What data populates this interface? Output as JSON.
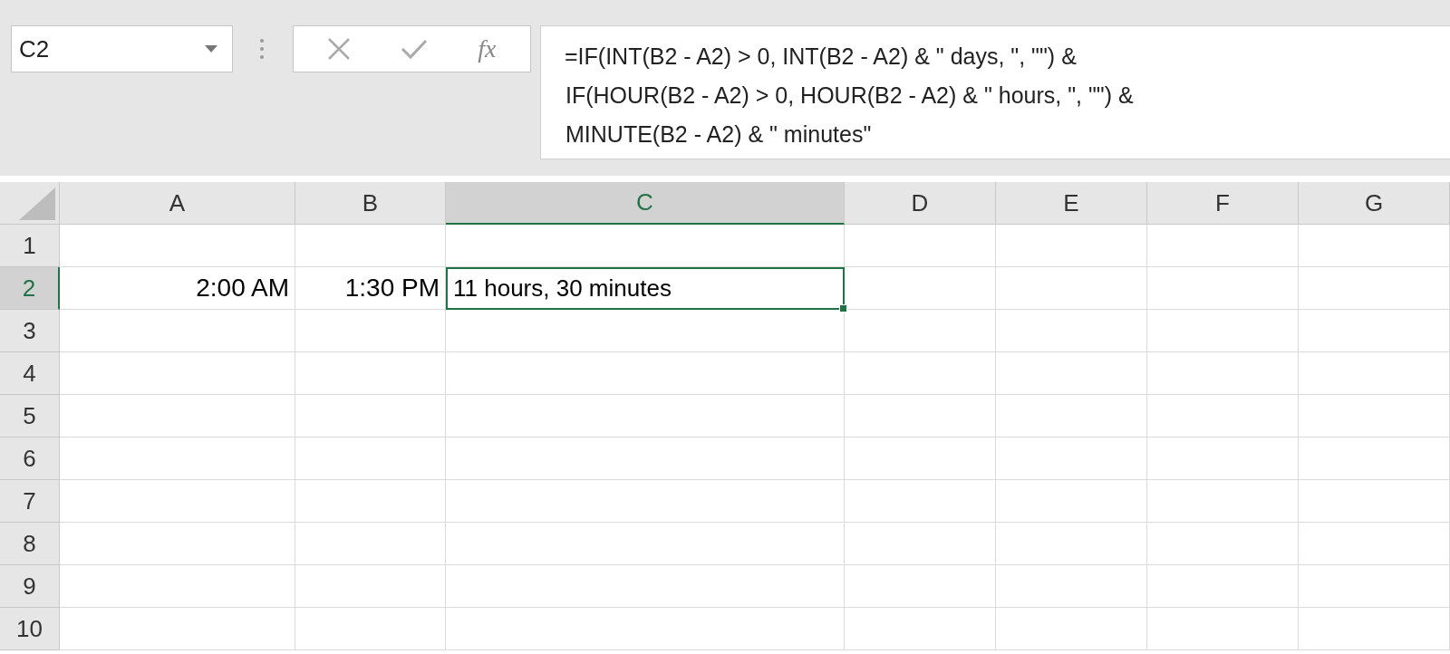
{
  "name_box": {
    "value": "C2"
  },
  "formula_bar": {
    "function_label": "fx",
    "lines": [
      "=IF(INT(B2 - A2) > 0, INT(B2 - A2) & \" days, \", \"\") &",
      "IF(HOUR(B2 - A2) > 0, HOUR(B2 - A2) & \" hours, \", \"\") &",
      "MINUTE(B2 - A2) & \" minutes\""
    ]
  },
  "columns": [
    {
      "label": "A",
      "selected": false
    },
    {
      "label": "B",
      "selected": false
    },
    {
      "label": "C",
      "selected": true
    },
    {
      "label": "D",
      "selected": false
    },
    {
      "label": "E",
      "selected": false
    },
    {
      "label": "F",
      "selected": false
    },
    {
      "label": "G",
      "selected": false
    }
  ],
  "rows": [
    {
      "label": "1",
      "selected": false,
      "cells": [
        "",
        "",
        "",
        "",
        "",
        "",
        ""
      ]
    },
    {
      "label": "2",
      "selected": true,
      "cells": [
        "2:00 AM",
        "1:30 PM",
        "11 hours, 30 minutes",
        "",
        "",
        "",
        ""
      ]
    },
    {
      "label": "3",
      "selected": false,
      "cells": [
        "",
        "",
        "",
        "",
        "",
        "",
        ""
      ]
    },
    {
      "label": "4",
      "selected": false,
      "cells": [
        "",
        "",
        "",
        "",
        "",
        "",
        ""
      ]
    },
    {
      "label": "5",
      "selected": false,
      "cells": [
        "",
        "",
        "",
        "",
        "",
        "",
        ""
      ]
    },
    {
      "label": "6",
      "selected": false,
      "cells": [
        "",
        "",
        "",
        "",
        "",
        "",
        ""
      ]
    },
    {
      "label": "7",
      "selected": false,
      "cells": [
        "",
        "",
        "",
        "",
        "",
        "",
        ""
      ]
    },
    {
      "label": "8",
      "selected": false,
      "cells": [
        "",
        "",
        "",
        "",
        "",
        "",
        ""
      ]
    },
    {
      "label": "9",
      "selected": false,
      "cells": [
        "",
        "",
        "",
        "",
        "",
        "",
        ""
      ]
    },
    {
      "label": "10",
      "selected": false,
      "cells": [
        "",
        "",
        "",
        "",
        "",
        "",
        ""
      ]
    }
  ]
}
